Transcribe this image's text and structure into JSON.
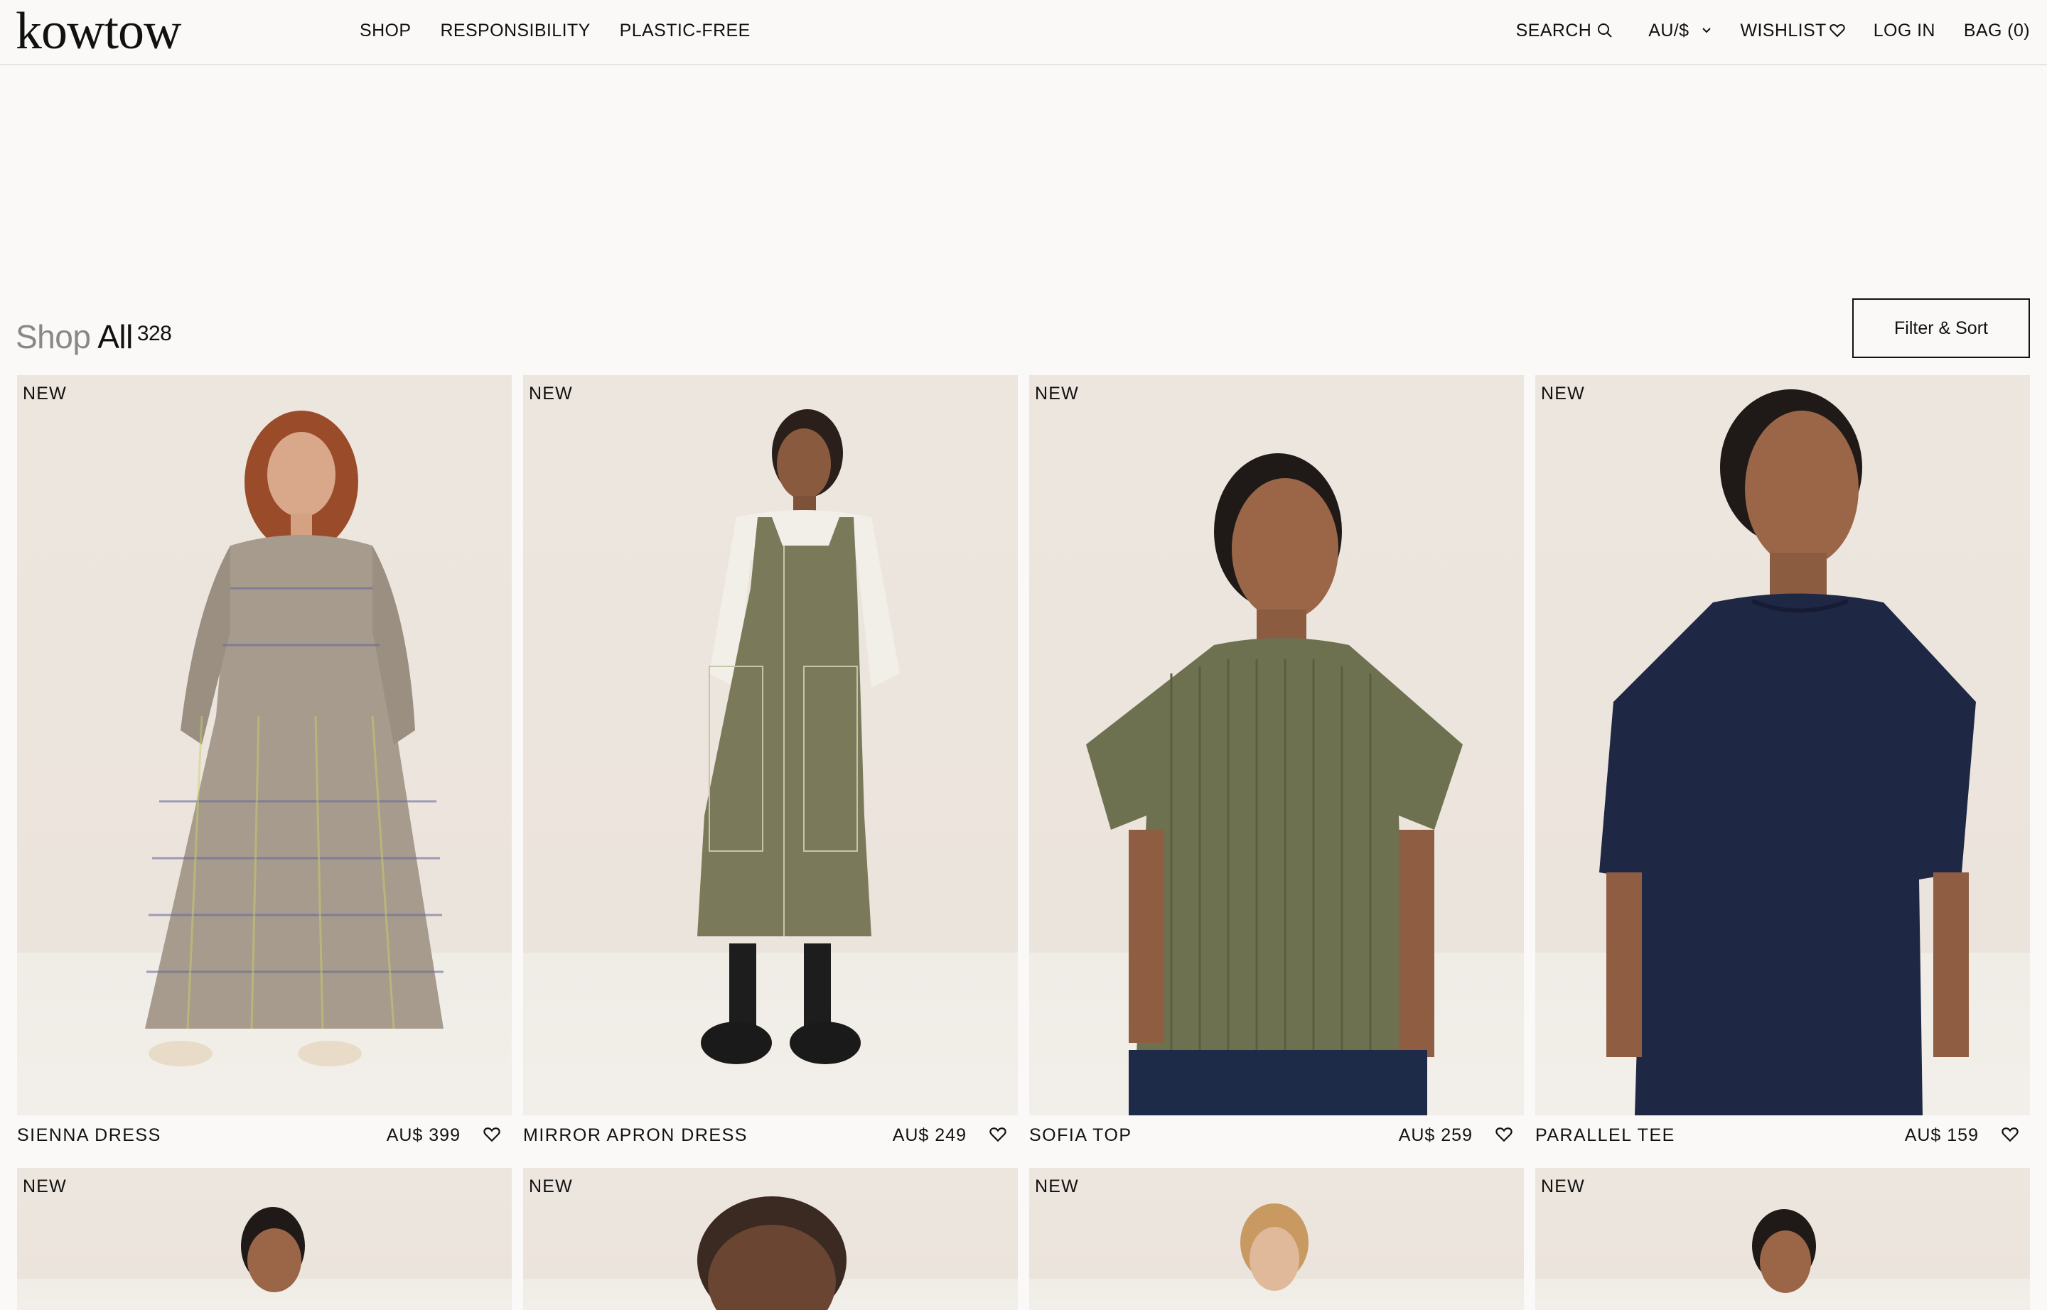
{
  "brand": {
    "logo_text": "kowtow"
  },
  "nav": {
    "left": [
      "SHOP",
      "RESPONSIBILITY",
      "PLASTIC-FREE"
    ],
    "search": "SEARCH",
    "currency": "AU/$",
    "wishlist": "WISHLIST",
    "login": "LOG IN",
    "bag": "BAG (0)"
  },
  "page": {
    "title_prefix": "Shop",
    "title_main": "All",
    "count": "328",
    "filter_label": "Filter & Sort"
  },
  "products": [
    {
      "badge": "NEW",
      "name": "SIENNA DRESS",
      "price": "AU$ 399"
    },
    {
      "badge": "NEW",
      "name": "MIRROR APRON DRESS",
      "price": "AU$ 249"
    },
    {
      "badge": "NEW",
      "name": "SOFIA TOP",
      "price": "AU$ 259"
    },
    {
      "badge": "NEW",
      "name": "PARALLEL TEE",
      "price": "AU$ 159"
    },
    {
      "badge": "NEW"
    },
    {
      "badge": "NEW"
    },
    {
      "badge": "NEW"
    },
    {
      "badge": "NEW"
    }
  ],
  "colors": {
    "background": "#faf9f7",
    "text": "#111111",
    "muted": "#8a8784",
    "image_bg": "#ede6df"
  }
}
